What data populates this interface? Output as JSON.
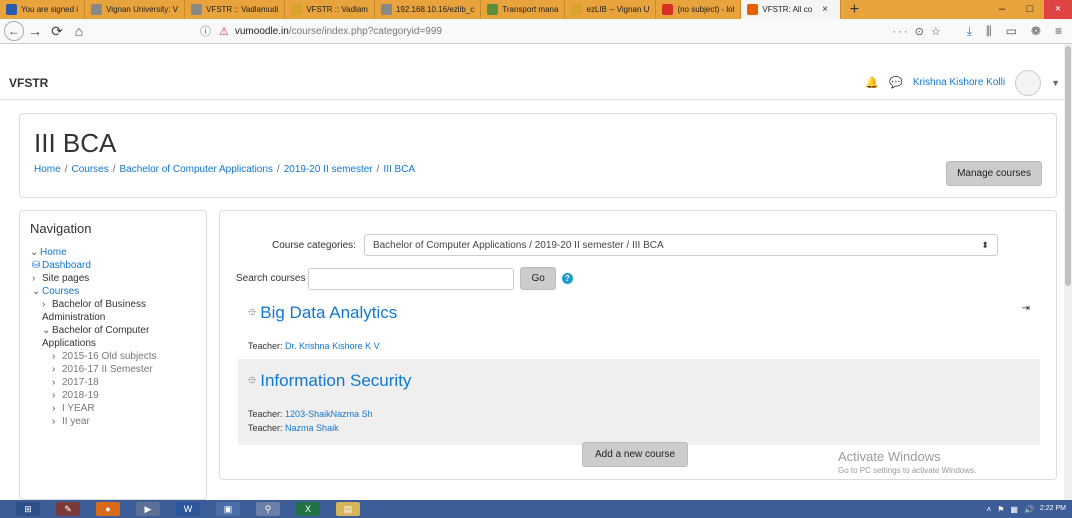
{
  "browser": {
    "tabs": [
      {
        "label": "You are signed i",
        "color": "#2b5aa8"
      },
      {
        "label": "Vignan University: V",
        "color": "#888888"
      },
      {
        "label": "VFSTR :: Vadlamudi",
        "color": "#888888"
      },
      {
        "label": "VFSTR :: Vadlam",
        "color": "#d8a32a"
      },
      {
        "label": "192.168.10.16/ezlib_c",
        "color": "#888888"
      },
      {
        "label": "Transport mana",
        "color": "#5a8f3a"
      },
      {
        "label": "ezLIB -- Vignan U",
        "color": "#d8a32a"
      },
      {
        "label": "(no subject) - lol",
        "color": "#d93025"
      },
      {
        "label": "VFSTR: All co",
        "color": "#e66000",
        "active": true
      }
    ],
    "new_tab": "+",
    "window_controls": {
      "minimize": "–",
      "maximize": "□",
      "close": "×"
    },
    "url": {
      "host": "vumoodle.in",
      "path": "/course/index.php?categoryid=999",
      "overflow": "···"
    }
  },
  "header": {
    "brand": "VFSTR",
    "user_name": "Krishna Kishore Kolli"
  },
  "page": {
    "title": "III BCA",
    "breadcrumb": [
      "Home",
      "Courses",
      "Bachelor of Computer Applications",
      "2019-20 II semester",
      "III BCA"
    ],
    "manage_courses": "Manage courses"
  },
  "navigation": {
    "title": "Navigation",
    "items": [
      {
        "label": "Home",
        "indicator": "⌄",
        "style": "link",
        "level": 1
      },
      {
        "label": "Dashboard",
        "indicator": "",
        "style": "link",
        "level": 2
      },
      {
        "label": "Site pages",
        "indicator": "›",
        "style": "plain",
        "level": 2
      },
      {
        "label": "Courses",
        "indicator": "⌄",
        "style": "link",
        "level": 2
      },
      {
        "label": "Bachelor of Business Administration",
        "indicator": "›",
        "style": "plain",
        "level": 3
      },
      {
        "label": "Bachelor of Computer Applications",
        "indicator": "⌄",
        "style": "plain",
        "level": 3
      },
      {
        "label": "2015-16 Old subjects",
        "indicator": "›",
        "style": "muted",
        "level": 4
      },
      {
        "label": "2016-17 II Semester",
        "indicator": "›",
        "style": "muted",
        "level": 4
      },
      {
        "label": "2017-18",
        "indicator": "›",
        "style": "muted",
        "level": 4
      },
      {
        "label": "2018-19",
        "indicator": "›",
        "style": "muted",
        "level": 4
      },
      {
        "label": "I YEAR",
        "indicator": "›",
        "style": "muted",
        "level": 4
      },
      {
        "label": "II year",
        "indicator": "›",
        "style": "muted",
        "level": 4
      }
    ]
  },
  "main": {
    "categories_label": "Course categories:",
    "category_selected": "Bachelor of Computer Applications / 2019-20 II semester / III BCA",
    "search_label": "Search courses",
    "search_value": "",
    "go_label": "Go",
    "courses": [
      {
        "name": "Big Data Analytics",
        "teachers": [
          "Dr. Krishna Kishore K V"
        ]
      },
      {
        "name": "Information Security",
        "teachers": [
          "1203-ShaikNazma Sh",
          "Nazma Shaik"
        ]
      }
    ],
    "teacher_prefix": "Teacher:",
    "add_course": "Add a new course"
  },
  "watermark": {
    "line1": "Activate Windows",
    "line2": "Go to PC settings to activate Windows."
  },
  "taskbar": {
    "clock_time": "2:22 PM"
  }
}
